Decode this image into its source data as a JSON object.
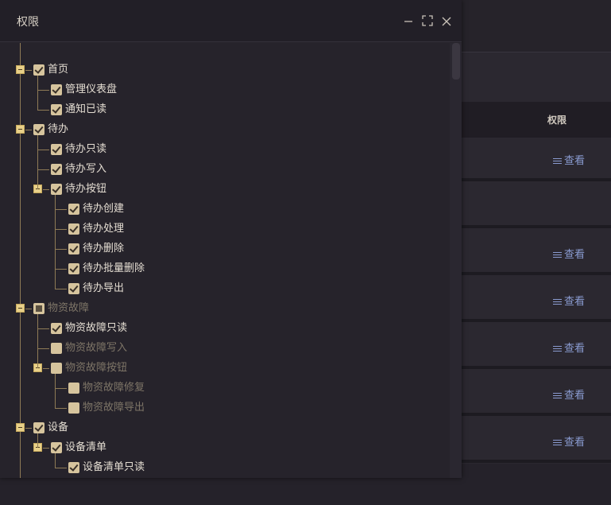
{
  "dialog": {
    "title": "权限",
    "buttons": {
      "minimize": "minimize-icon",
      "maximize": "fullscreen-icon",
      "close": "close-icon"
    }
  },
  "background_table": {
    "column_header": "权限",
    "row_action": "查看",
    "rows_with_action": [
      true,
      false,
      true,
      true,
      true,
      true,
      true
    ]
  },
  "tree": [
    {
      "label": "首页",
      "state": "checked",
      "expanded": true,
      "children": [
        {
          "label": "管理仪表盘",
          "state": "checked"
        },
        {
          "label": "通知已读",
          "state": "checked"
        }
      ]
    },
    {
      "label": "待办",
      "state": "checked",
      "expanded": true,
      "children": [
        {
          "label": "待办只读",
          "state": "checked"
        },
        {
          "label": "待办写入",
          "state": "checked"
        },
        {
          "label": "待办按钮",
          "state": "checked",
          "expanded": true,
          "children": [
            {
              "label": "待办创建",
              "state": "checked"
            },
            {
              "label": "待办处理",
              "state": "checked"
            },
            {
              "label": "待办删除",
              "state": "checked"
            },
            {
              "label": "待办批量删除",
              "state": "checked"
            },
            {
              "label": "待办导出",
              "state": "checked"
            }
          ]
        }
      ]
    },
    {
      "label": "物资故障",
      "state": "partial",
      "expanded": true,
      "children": [
        {
          "label": "物资故障只读",
          "state": "checked"
        },
        {
          "label": "物资故障写入",
          "state": "unchecked"
        },
        {
          "label": "物资故障按钮",
          "state": "unchecked",
          "expanded": true,
          "children": [
            {
              "label": "物资故障修复",
              "state": "unchecked"
            },
            {
              "label": "物资故障导出",
              "state": "unchecked"
            }
          ]
        }
      ]
    },
    {
      "label": "设备",
      "state": "checked",
      "expanded": true,
      "children": [
        {
          "label": "设备清单",
          "state": "checked",
          "expanded": true,
          "children": [
            {
              "label": "设备清单只读",
              "state": "checked"
            }
          ]
        }
      ]
    }
  ],
  "colors": {
    "checkbox": "#d6c49d",
    "toggle": "#e8d089",
    "guide_line": "#8f7b56",
    "link": "#8a9bd0"
  }
}
